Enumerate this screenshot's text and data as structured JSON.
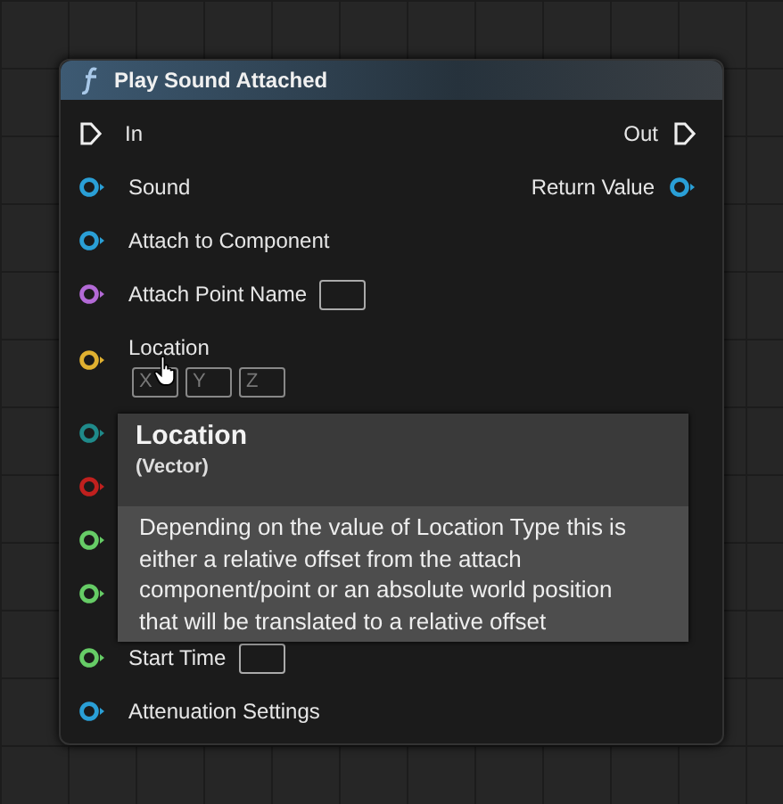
{
  "node": {
    "title": "Play Sound Attached",
    "pins": [
      {
        "kind": "exec",
        "label": "In",
        "right_label": "Out"
      },
      {
        "kind": "data",
        "label": "Sound",
        "color": "#2a9fd6",
        "right_label": "Return Value"
      },
      {
        "kind": "data",
        "label": "Attach to Component",
        "color": "#2a9fd6"
      },
      {
        "kind": "data",
        "label": "Attach Point Name",
        "color": "#b36ad6",
        "field": true
      },
      {
        "kind": "vector",
        "label": "Location",
        "color": "#e0b030",
        "fields": [
          "X",
          "Y",
          "Z"
        ]
      },
      {
        "kind": "data",
        "color": "#1f8a8a"
      },
      {
        "kind": "data",
        "color": "#c0201e"
      },
      {
        "kind": "data",
        "color": "#66cc66"
      },
      {
        "kind": "data",
        "color": "#66cc66"
      },
      {
        "kind": "data",
        "label": "Start Time",
        "color": "#66cc66",
        "field": true
      },
      {
        "kind": "data",
        "label": "Attenuation Settings",
        "color": "#2a9fd6"
      }
    ]
  },
  "tooltip": {
    "title": "Location",
    "subtitle": "(Vector)",
    "body": "Depending on the value of Location Type this is either a relative offset from the attach component/point or an absolute world position that will be translated to a relative offset"
  }
}
